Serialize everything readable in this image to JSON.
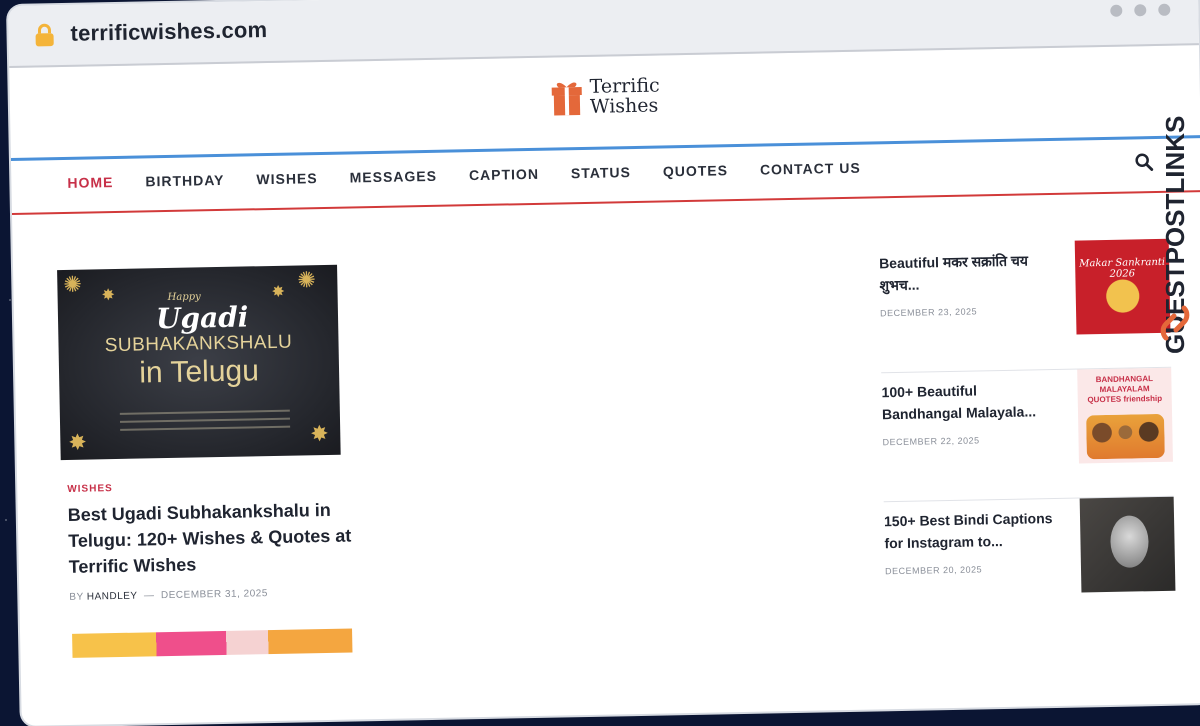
{
  "browser": {
    "url": "terrificwishes.com"
  },
  "logo": {
    "line1": "Terrific",
    "line2": "Wishes"
  },
  "nav": {
    "items": [
      "HOME",
      "BIRTHDAY",
      "WISHES",
      "MESSAGES",
      "CAPTION",
      "STATUS",
      "QUOTES",
      "CONTACT US"
    ],
    "active": "HOME"
  },
  "featured": {
    "image": {
      "happy": "Happy",
      "ugadi": "Ugadi",
      "line1": "SUBHAKANKSHALU",
      "line2": "in Telugu"
    },
    "category": "WISHES",
    "title": "Best Ugadi Subhakankshalu in Telugu: 120+ Wishes & Quotes at Terrific Wishes",
    "by": "BY",
    "author": "HANDLEY",
    "date": "DECEMBER 31, 2025"
  },
  "sidebar": {
    "items": [
      {
        "title": "Beautiful मकर सक्रांति चय शुभच...",
        "date": "DECEMBER 23, 2025",
        "thumb_text": "Makar Sankranti 2026"
      },
      {
        "title": "100+ Beautiful Bandhangal Malayala...",
        "date": "DECEMBER 22, 2025",
        "thumb_text": "BANDHANGAL MALAYALAM QUOTES friendship"
      },
      {
        "title": "150+ Best Bindi Captions for Instagram to...",
        "date": "DECEMBER 20, 2025",
        "thumb_text": ""
      }
    ]
  },
  "watermark": {
    "text": "GUESTPOSTLINKS"
  },
  "colors": {
    "accent": "#c73048",
    "nav_top": "#4a90d9",
    "nav_bottom": "#d23a3a",
    "logo_gift": "#e4683a"
  }
}
